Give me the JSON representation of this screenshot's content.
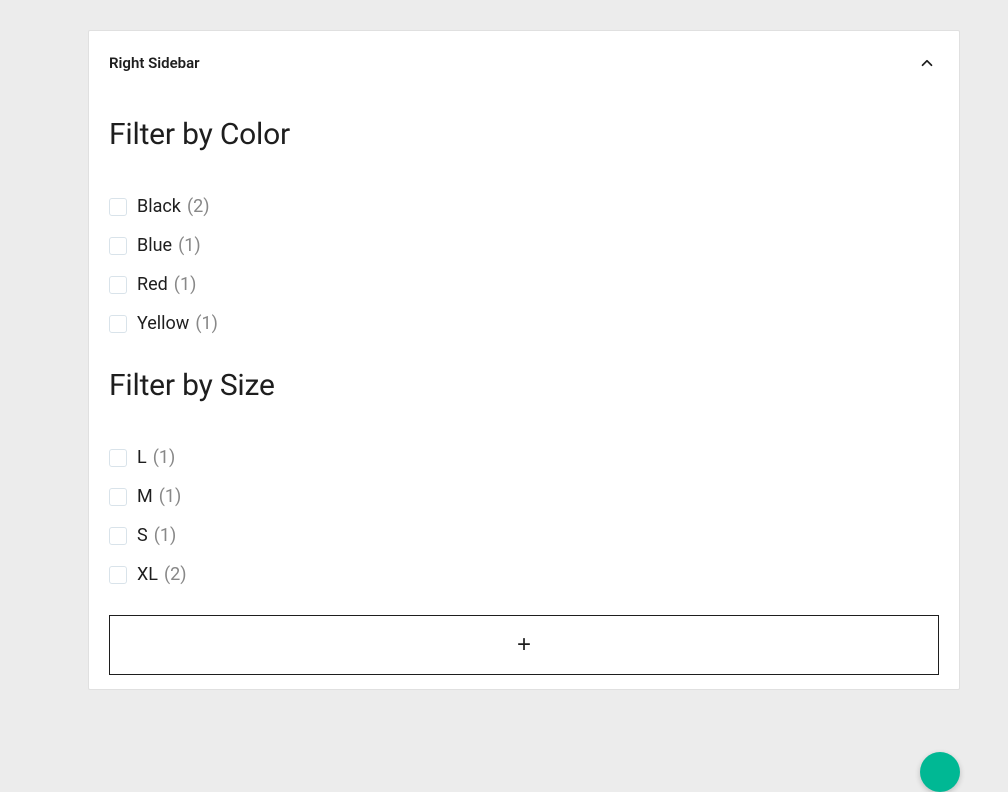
{
  "panel": {
    "title": "Right Sidebar"
  },
  "filters": {
    "color": {
      "heading": "Filter by Color",
      "items": [
        {
          "label": "Black",
          "count": "(2)"
        },
        {
          "label": "Blue",
          "count": "(1)"
        },
        {
          "label": "Red",
          "count": "(1)"
        },
        {
          "label": "Yellow",
          "count": "(1)"
        }
      ]
    },
    "size": {
      "heading": "Filter by Size",
      "items": [
        {
          "label": "L",
          "count": "(1)"
        },
        {
          "label": "M",
          "count": "(1)"
        },
        {
          "label": "S",
          "count": "(1)"
        },
        {
          "label": "XL",
          "count": "(2)"
        }
      ]
    }
  },
  "addButton": {
    "label": "+"
  }
}
